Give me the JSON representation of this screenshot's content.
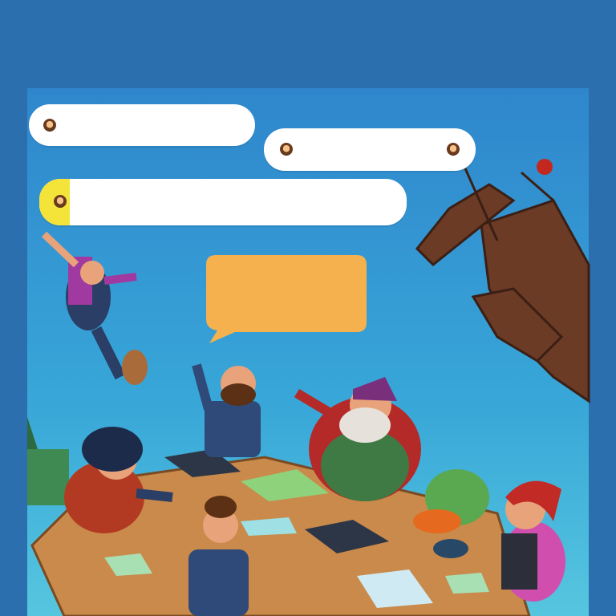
{
  "scene": {
    "description_visible_text": "",
    "colors": {
      "top_band": "#2a6fb0",
      "sky_top": "#2f8ad0",
      "sky_bottom": "#4fc3e0",
      "bubble": "#ffffff",
      "bubble_accent": "#f4e43a",
      "speech_orange": "#f6b14f",
      "table": "#c8874a",
      "wood_dark": "#5a3423"
    },
    "bubbles": [
      {
        "text": ""
      },
      {
        "text": ""
      },
      {
        "text": ""
      },
      {
        "text": ""
      }
    ]
  }
}
